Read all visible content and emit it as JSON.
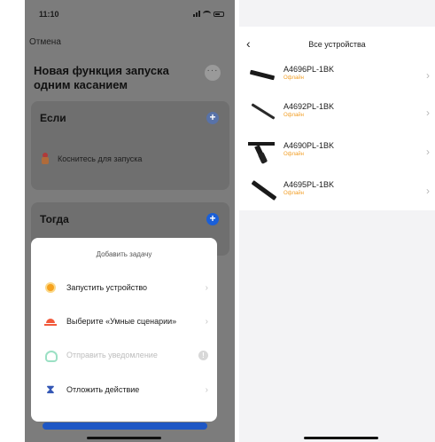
{
  "left": {
    "status": {
      "time": "11:10"
    },
    "cancel": "Отмена",
    "title": "Новая функция запуска одним касанием",
    "more": "···",
    "if_card": {
      "title": "Если",
      "plus": "+",
      "tap_text": "Коснитесь для запуска"
    },
    "then_card": {
      "title": "Тогда",
      "plus": "+"
    },
    "sheet": {
      "title": "Добавить задачу",
      "items": [
        {
          "label": "Запустить устройство",
          "icon": "sun-icon",
          "chevron": "›"
        },
        {
          "label": "Выберите «Умные сценарии»",
          "icon": "sunset-icon",
          "chevron": "›"
        },
        {
          "label": "Отправить уведомление",
          "icon": "bell-icon",
          "disabled": true,
          "info": "!"
        },
        {
          "label": "Отложить действие",
          "icon": "hourglass-icon",
          "chevron": "›"
        }
      ]
    }
  },
  "right": {
    "back": "‹",
    "title": "Все устройства",
    "devices": [
      {
        "name": "A4696PL-1BK",
        "status": "Офлайн",
        "chevron": "›"
      },
      {
        "name": "A4692PL-1BK",
        "status": "Офлайн",
        "chevron": "›"
      },
      {
        "name": "A4690PL-1BK",
        "status": "Офлайн",
        "chevron": "›"
      },
      {
        "name": "A4695PL-1BK",
        "status": "Офлайн",
        "chevron": "›"
      }
    ]
  },
  "colors": {
    "accent_blue": "#1a5fd8",
    "offline_orange": "#f2a02a",
    "overlay_gray": "#7c7c7c"
  }
}
